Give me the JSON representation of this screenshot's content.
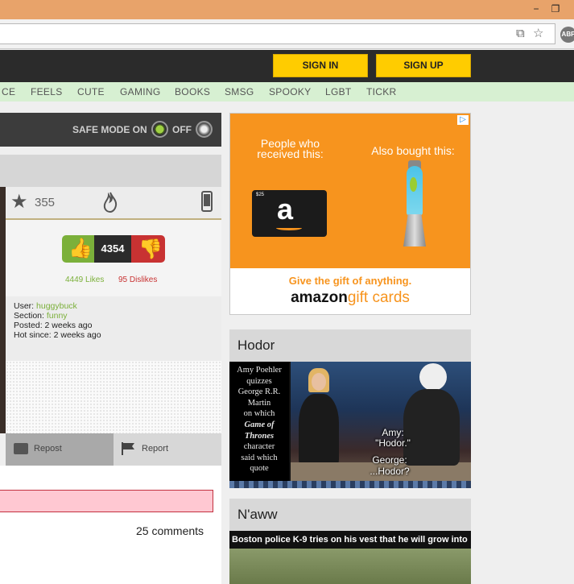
{
  "browser": {
    "minimize": "−",
    "restore": "❐",
    "abp": "ABP"
  },
  "header": {
    "sign_in": "SIGN IN",
    "sign_up": "SIGN UP"
  },
  "categories": [
    "CE",
    "FEELS",
    "CUTE",
    "GAMING",
    "BOOKS",
    "SMSG",
    "SPOOKY",
    "LGBT",
    "TICKR"
  ],
  "safe_mode": {
    "label": "SAFE MODE ON",
    "off_label": "OFF"
  },
  "post": {
    "favorites": "355",
    "score": "4354",
    "likes": "4449 Likes",
    "dislikes": "95 Dislikes",
    "user_label": "User:",
    "user": "huggybuck",
    "section_label": "Section:",
    "section": "funny",
    "posted": "Posted: 2 weeks ago",
    "hot_since": "Hot since: 2 weeks ago",
    "repost": "Repost",
    "report": "Report",
    "comments": "25 comments"
  },
  "ad": {
    "people_who": "People who received this:",
    "also_bought": "Also bought this:",
    "card_value": "$25",
    "gift_line": "Give the gift of anything.",
    "brand": "amazon",
    "brand_suffix": "gift cards"
  },
  "sidebar": {
    "hodor": {
      "title": "Hodor",
      "quiz_text": [
        "Amy Poehler",
        "quizzes",
        "George R.R.",
        "Martin",
        "on which",
        "Game of",
        "Thrones",
        "character",
        "said which",
        "quote"
      ],
      "sub_amy": "Amy:",
      "sub_hodor": "\"Hodor.\"",
      "sub_george": "George:",
      "sub_george_line": "...Hodor?"
    },
    "naww": {
      "title": "N'aww",
      "caption": "Boston police K-9 tries on his vest that he will grow into"
    }
  },
  "colors": {
    "accent_yellow": "#ffcc00",
    "like_green": "#7bb03a",
    "dislike_red": "#c83232",
    "ad_orange": "#f7941e"
  }
}
